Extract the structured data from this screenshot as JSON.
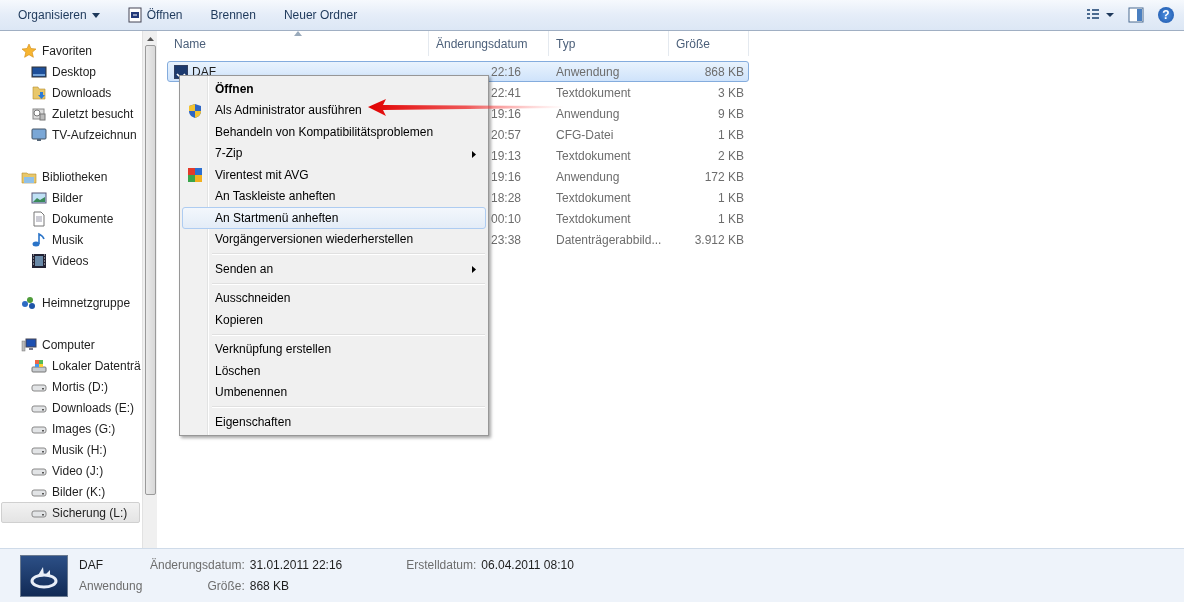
{
  "toolbar": {
    "buttons": [
      {
        "label": "Organisieren",
        "kind": "menu"
      },
      {
        "label": "Öffnen",
        "kind": "open"
      },
      {
        "label": "Brennen",
        "kind": "plain"
      },
      {
        "label": "Neuer Ordner",
        "kind": "plain"
      }
    ],
    "help": "?"
  },
  "sidebar": {
    "groups": [
      {
        "label": "Favoriten",
        "kind": "star",
        "children": [
          {
            "label": "Desktop",
            "kind": "desktop",
            "selected": false
          },
          {
            "label": "Downloads",
            "kind": "download",
            "selected": false
          },
          {
            "label": "Zuletzt besucht",
            "kind": "recent",
            "selected": false
          },
          {
            "label": "TV-Aufzeichnun",
            "kind": "monitor",
            "selected": false
          }
        ]
      },
      {
        "label": "Bibliotheken",
        "kind": "library",
        "children": [
          {
            "label": "Bilder",
            "kind": "image",
            "selected": false
          },
          {
            "label": "Dokumente",
            "kind": "document",
            "selected": false
          },
          {
            "label": "Musik",
            "kind": "music",
            "selected": false
          },
          {
            "label": "Videos",
            "kind": "video",
            "selected": false
          }
        ]
      },
      {
        "label": "Heimnetzgruppe",
        "kind": "network"
      },
      {
        "label": "Computer",
        "kind": "computer",
        "children": [
          {
            "label": "Lokaler Datenträ",
            "kind": "system",
            "selected": false
          },
          {
            "label": "Mortis (D:)",
            "kind": "drive",
            "selected": false
          },
          {
            "label": "Downloads (E:)",
            "kind": "drive",
            "selected": false
          },
          {
            "label": "Images (G:)",
            "kind": "drive",
            "selected": false
          },
          {
            "label": "Musik (H:)",
            "kind": "drive",
            "selected": false
          },
          {
            "label": "Video (J:)",
            "kind": "drive",
            "selected": false
          },
          {
            "label": "Bilder (K:)",
            "kind": "drive",
            "selected": false
          },
          {
            "label": "Sicherung (L:)",
            "kind": "drive",
            "selected": true
          }
        ]
      }
    ]
  },
  "files": {
    "columns": [
      {
        "label": "Name",
        "sorted": true
      },
      {
        "label": "Änderungsdatum",
        "sorted": false
      },
      {
        "label": "Typ",
        "sorted": false
      },
      {
        "label": "Größe",
        "sorted": false
      }
    ],
    "rows": [
      {
        "name": "DAF",
        "date": "22:16",
        "type": "Anwendung",
        "size": "868 KB",
        "selected": true
      },
      {
        "date": "22:41",
        "type": "Textdokument",
        "size": "3 KB",
        "selected": false
      },
      {
        "date": "19:16",
        "type": "Anwendung",
        "size": "9 KB",
        "selected": false
      },
      {
        "date": "20:57",
        "type": "CFG-Datei",
        "size": "1 KB",
        "selected": false
      },
      {
        "date": "19:13",
        "type": "Textdokument",
        "size": "2 KB",
        "selected": false
      },
      {
        "date": "19:16",
        "type": "Anwendung",
        "size": "172 KB",
        "selected": false
      },
      {
        "date": "18:28",
        "type": "Textdokument",
        "size": "1 KB",
        "selected": false
      },
      {
        "date": "00:10",
        "type": "Textdokument",
        "size": "1 KB",
        "selected": false
      },
      {
        "date": "23:38",
        "type": "Datenträgerabbild...",
        "size": "3.912 KB",
        "selected": false
      }
    ]
  },
  "context_menu": {
    "groups": [
      {
        "items": [
          {
            "label": "Öffnen",
            "kind": "text",
            "default": true,
            "submenu": false,
            "selected": false
          },
          {
            "label": "Als Administrator ausführen",
            "kind": "shield",
            "default": false,
            "submenu": false,
            "selected": false
          },
          {
            "label": "Behandeln von Kompatibilitätsproblemen",
            "kind": "text",
            "default": false,
            "submenu": false,
            "selected": false
          },
          {
            "label": "7-Zip",
            "kind": "text",
            "default": false,
            "submenu": true,
            "selected": false
          },
          {
            "label": "Virentest mit AVG",
            "kind": "tiles",
            "default": false,
            "submenu": false,
            "selected": false
          },
          {
            "label": "An Taskleiste anheften",
            "kind": "text",
            "default": false,
            "submenu": false,
            "selected": false
          },
          {
            "label": "An Startmenü anheften",
            "kind": "text",
            "default": false,
            "submenu": false,
            "selected": true
          },
          {
            "label": "Vorgängerversionen wiederherstellen",
            "kind": "text",
            "default": false,
            "submenu": false,
            "selected": false
          }
        ]
      },
      {
        "items": [
          {
            "label": "Senden an",
            "kind": "text",
            "default": false,
            "submenu": true,
            "selected": false
          }
        ]
      },
      {
        "items": [
          {
            "label": "Ausschneiden",
            "kind": "text",
            "default": false,
            "submenu": false,
            "selected": false
          },
          {
            "label": "Kopieren",
            "kind": "text",
            "default": false,
            "submenu": false,
            "selected": false
          }
        ]
      },
      {
        "items": [
          {
            "label": "Verknüpfung erstellen",
            "kind": "text",
            "default": false,
            "submenu": false,
            "selected": false
          },
          {
            "label": "Löschen",
            "kind": "text",
            "default": false,
            "submenu": false,
            "selected": false
          },
          {
            "label": "Umbenennen",
            "kind": "text",
            "default": false,
            "submenu": false,
            "selected": false
          }
        ]
      },
      {
        "items": [
          {
            "label": "Eigenschaften",
            "kind": "text",
            "default": false,
            "submenu": false,
            "selected": false
          }
        ]
      }
    ]
  },
  "details": {
    "name": "DAF",
    "type": "Anwendung",
    "fields": [
      {
        "label": "Änderungsdatum:",
        "value": "31.01.2011 22:16"
      },
      {
        "label": "Größe:",
        "value": "868 KB"
      },
      {
        "label": "Erstelldatum:",
        "value": "06.04.2011 08:10"
      }
    ]
  }
}
